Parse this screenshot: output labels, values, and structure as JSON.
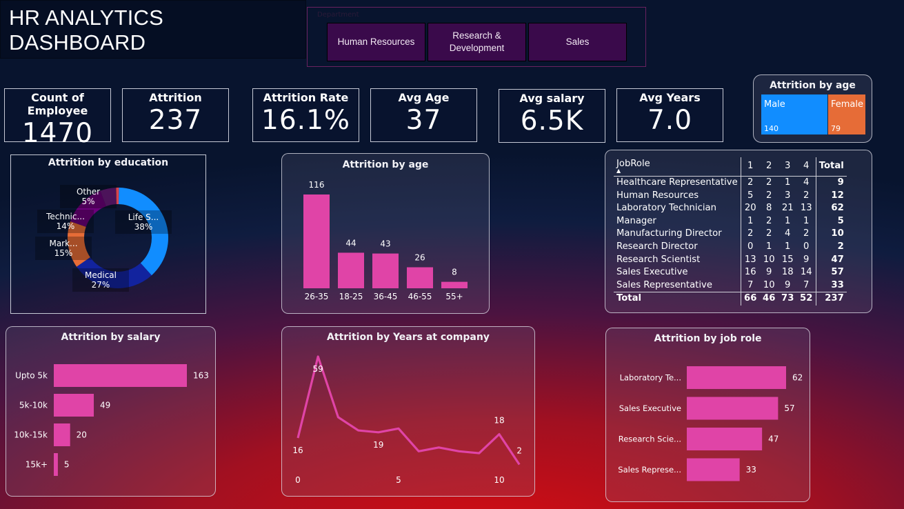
{
  "title": "HR ANALYTICS DASHBOARD",
  "department_slicer": {
    "label": "Department",
    "options": [
      "Human Resources",
      "Research &\nDevelopment",
      "Sales"
    ]
  },
  "kpis": [
    {
      "label": "Count of Employee",
      "value": "1470"
    },
    {
      "label": "Attrition",
      "value": "237"
    },
    {
      "label": "Attrition Rate",
      "value": "16.1%"
    },
    {
      "label": "Avg Age",
      "value": "37"
    },
    {
      "label": "Avg salary",
      "value": "6.5K"
    },
    {
      "label": "Avg Years",
      "value": "7.0"
    }
  ],
  "gender_tile": {
    "title": "Attrition by age",
    "items": [
      {
        "label": "Male",
        "value": "140",
        "color": "#118dff"
      },
      {
        "label": "Female",
        "value": "79",
        "color": "#e66c37"
      }
    ]
  },
  "education_chart": {
    "title": "Attrition by education",
    "chart_data": {
      "type": "pie",
      "slices": [
        {
          "name": "Life S...",
          "percent": 38,
          "label": "38%",
          "color": "#118dff"
        },
        {
          "name": "Medical",
          "percent": 27,
          "label": "27%",
          "color": "#12239e"
        },
        {
          "name": "Mark...",
          "percent": 15,
          "label": "15%",
          "color": "#e66c37"
        },
        {
          "name": "Technic...",
          "percent": 14,
          "label": "14%",
          "color": "#6b007b"
        },
        {
          "name": "Other",
          "percent": 5,
          "label": "5%",
          "color": "#6a1b7d"
        },
        {
          "name": "",
          "percent": 1,
          "label": "",
          "color": "#d64550"
        }
      ]
    }
  },
  "age_chart": {
    "title": "Attrition by age",
    "chart_data": {
      "type": "bar",
      "categories": [
        "26-35",
        "18-25",
        "36-45",
        "46-55",
        "55+"
      ],
      "values": [
        116,
        44,
        43,
        26,
        8
      ],
      "color": "#e044a7"
    }
  },
  "jobrole_matrix": {
    "headers": [
      "JobRole",
      "1",
      "2",
      "3",
      "4",
      "Total"
    ],
    "rows": [
      [
        "Healthcare Representative",
        "2",
        "2",
        "1",
        "4",
        "9"
      ],
      [
        "Human Resources",
        "5",
        "2",
        "3",
        "2",
        "12"
      ],
      [
        "Laboratory Technician",
        "20",
        "8",
        "21",
        "13",
        "62"
      ],
      [
        "Manager",
        "1",
        "2",
        "1",
        "1",
        "5"
      ],
      [
        "Manufacturing Director",
        "2",
        "2",
        "4",
        "2",
        "10"
      ],
      [
        "Research Director",
        "0",
        "1",
        "1",
        "0",
        "2"
      ],
      [
        "Research Scientist",
        "13",
        "10",
        "15",
        "9",
        "47"
      ],
      [
        "Sales Executive",
        "16",
        "9",
        "18",
        "14",
        "57"
      ],
      [
        "Sales Representative",
        "7",
        "10",
        "9",
        "7",
        "33"
      ]
    ],
    "total": [
      "Total",
      "66",
      "46",
      "73",
      "52",
      "237"
    ]
  },
  "salary_chart": {
    "title": "Attrition by salary",
    "chart_data": {
      "type": "bar",
      "orientation": "horizontal",
      "categories": [
        "Upto 5k",
        "5k-10k",
        "10k-15k",
        "15k+"
      ],
      "values": [
        163,
        49,
        20,
        5
      ],
      "color": "#e044a7"
    }
  },
  "years_chart": {
    "title": "Attrition by Years at company",
    "chart_data": {
      "type": "line",
      "x": [
        0,
        1,
        2,
        3,
        4,
        5,
        6,
        7,
        8,
        9,
        10,
        11
      ],
      "values": [
        16,
        59,
        27,
        20,
        19,
        21,
        9,
        11,
        9,
        8,
        18,
        2
      ],
      "point_labels": [
        "16",
        "59",
        "",
        "",
        "19",
        "",
        "",
        "",
        "",
        "",
        "18",
        "2"
      ],
      "x_labels": [
        "0",
        "5",
        "10"
      ],
      "x_label_positions": [
        0,
        5,
        10
      ],
      "color": "#e044a7"
    }
  },
  "jobrole_chart": {
    "title": "Attrition by job role",
    "chart_data": {
      "type": "bar",
      "orientation": "horizontal",
      "categories": [
        "Laboratory Te...",
        "Sales Executive",
        "Research Scie...",
        "Sales Represe..."
      ],
      "values": [
        62,
        57,
        47,
        33
      ],
      "color": "#e044a7"
    }
  }
}
